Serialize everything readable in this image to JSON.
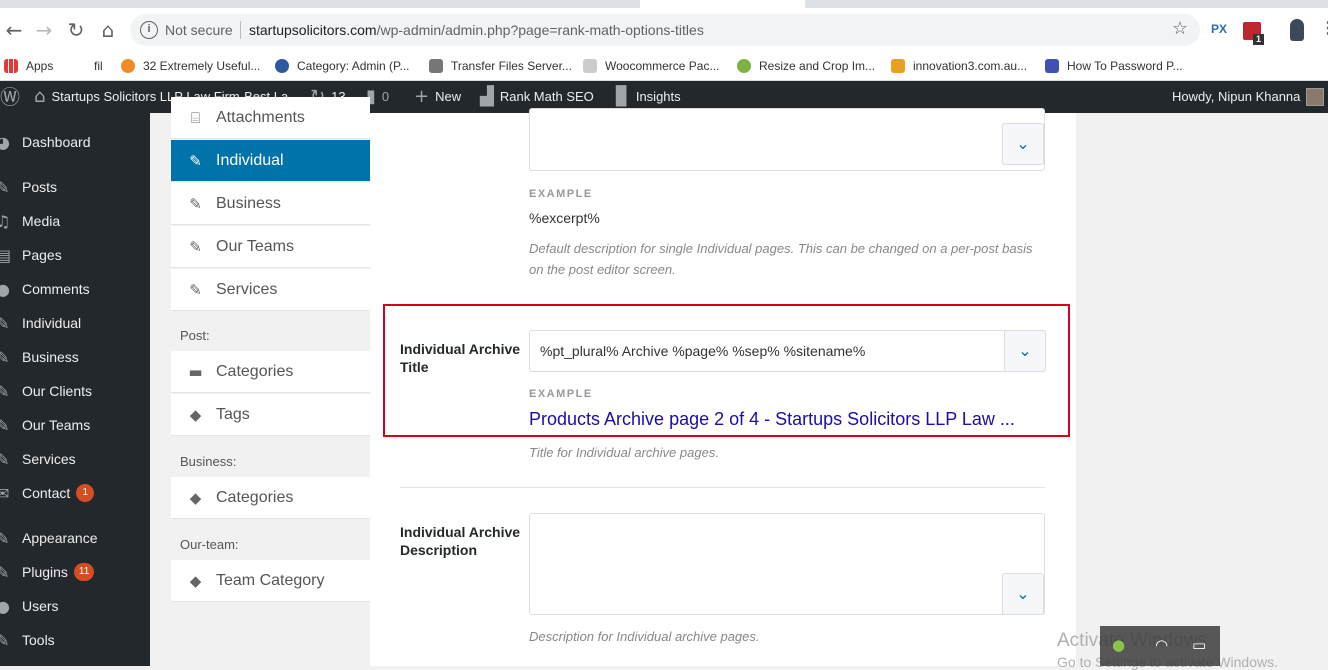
{
  "browser": {
    "url_host": "startupsolicitors.com",
    "url_path": "/wp-admin/admin.php?page=rank-math-options-titles",
    "security_label": "Not secure",
    "extensions": [
      "PX"
    ],
    "ext_badge": "1"
  },
  "bookmarks": [
    {
      "label": "Apps"
    },
    {
      "label": "fil"
    },
    {
      "label": "32 Extremely Useful..."
    },
    {
      "label": "Category: Admin (P..."
    },
    {
      "label": "Transfer Files Server..."
    },
    {
      "label": "Woocommerce Pac..."
    },
    {
      "label": "Resize and Crop Im..."
    },
    {
      "label": "innovation3.com.au..."
    },
    {
      "label": "How To Password P..."
    }
  ],
  "adminbar": {
    "site_name": "Startups Solicitors LLP Law Firm-Best La...",
    "updates_count": "13",
    "comments_count": "0",
    "new_label": "New",
    "rankmath_label": "Rank Math SEO",
    "insights_label": "Insights",
    "howdy": "Howdy, Nipun Khanna"
  },
  "adminmenu": [
    {
      "label": "Dashboard",
      "icon": "dashboard-icon"
    },
    {
      "label": "Posts",
      "icon": "pin-icon"
    },
    {
      "label": "Media",
      "icon": "media-icon"
    },
    {
      "label": "Pages",
      "icon": "pages-icon"
    },
    {
      "label": "Comments",
      "icon": "comment-icon"
    },
    {
      "label": "Individual",
      "icon": "pin-icon"
    },
    {
      "label": "Business",
      "icon": "pin-icon"
    },
    {
      "label": "Our Clients",
      "icon": "pin-icon"
    },
    {
      "label": "Our Teams",
      "icon": "pin-icon"
    },
    {
      "label": "Services",
      "icon": "pin-icon"
    },
    {
      "label": "Contact",
      "icon": "mail-icon",
      "badge": "1"
    },
    {
      "label": "Appearance",
      "icon": "brush-icon"
    },
    {
      "label": "Plugins",
      "icon": "plugin-icon",
      "badge": "11"
    },
    {
      "label": "Users",
      "icon": "user-icon"
    },
    {
      "label": "Tools",
      "icon": "wrench-icon"
    }
  ],
  "subnav": {
    "items_top": [
      {
        "label": "Attachments"
      },
      {
        "label": "Individual",
        "active": true
      },
      {
        "label": "Business"
      },
      {
        "label": "Our Teams"
      },
      {
        "label": "Services"
      }
    ],
    "post_header": "Post:",
    "post_items": [
      {
        "label": "Categories"
      },
      {
        "label": "Tags"
      }
    ],
    "business_header": "Business:",
    "business_items": [
      {
        "label": "Categories"
      }
    ],
    "team_header": "Our-team:",
    "team_items": [
      {
        "label": "Team Category"
      }
    ]
  },
  "main": {
    "example_label": "EXAMPLE",
    "single_desc_example": "%excerpt%",
    "single_desc_help": "Default description for single Individual pages. This can be changed on a per-post basis on the post editor screen.",
    "archive_title_label": "Individual Archive Title",
    "archive_title_value": "%pt_plural% Archive %page% %sep% %sitename%",
    "archive_title_example": "Products Archive page 2 of 4 - Startups Solicitors LLP Law ...",
    "archive_title_help": "Title for Individual archive pages.",
    "archive_desc_label": "Individual Archive Description",
    "archive_desc_help": "Description for Individual archive pages."
  },
  "windows": {
    "activate_line1": "Activate Windows",
    "activate_line2": "Go to Settings to activate Windows."
  }
}
